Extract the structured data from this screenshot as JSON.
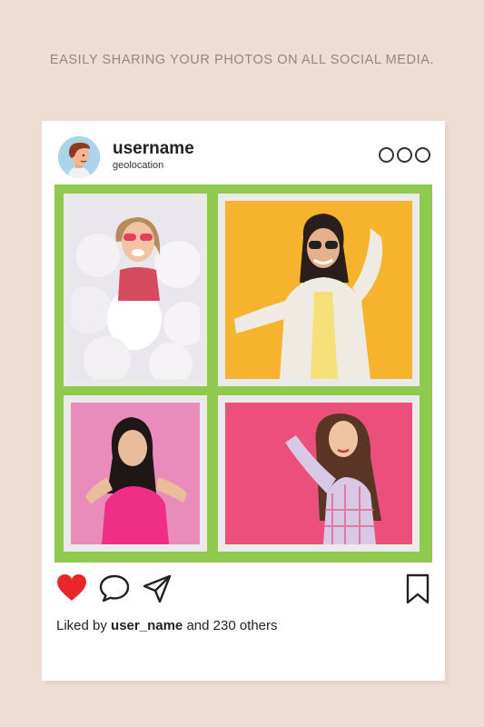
{
  "header": {
    "tagline": "EASILY SHARING YOUR PHOTOS ON ALL SOCIAL MEDIA."
  },
  "post": {
    "username": "username",
    "geolocation": "geolocation",
    "more_icon": "more-dots-icon",
    "avatar_icon": "avatar-cartoon-icon"
  },
  "collage": {
    "photos": [
      {
        "alt": "woman with white balloons"
      },
      {
        "alt": "woman in denim jacket on yellow"
      },
      {
        "alt": "woman in pink shirt on pink"
      },
      {
        "alt": "woman in plaid shirt on pink"
      }
    ]
  },
  "actions": {
    "like_icon": "heart-icon",
    "comment_icon": "comment-icon",
    "share_icon": "send-icon",
    "save_icon": "bookmark-icon"
  },
  "likes": {
    "prefix": "Liked by",
    "user": "user_name",
    "suffix": "and 230 others"
  },
  "colors": {
    "background": "#efdcd3",
    "frame": "#8fc94e",
    "heart": "#e8262b"
  }
}
